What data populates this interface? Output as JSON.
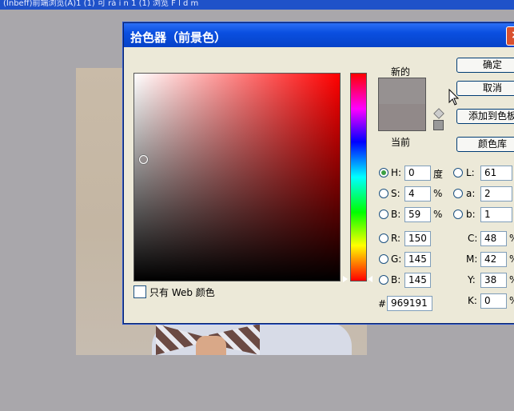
{
  "window": {
    "title": "(Inbeff)前端浏览(A)1 (1) 可 rà i n 1 (1) 浏览 F l d m"
  },
  "dialog": {
    "title": "拾色器（前景色）",
    "close_glyph": "×"
  },
  "preview": {
    "new_label": "新的",
    "current_label": "当前",
    "new_color": "#969191",
    "current_color": "#918989"
  },
  "buttons": {
    "ok": "确定",
    "cancel": "取消",
    "add_to_swatches": "添加到色板",
    "color_libraries": "颜色库"
  },
  "web_only_label": "只有 Web 颜色",
  "hsb": {
    "h": {
      "label": "H:",
      "value": "0",
      "unit": "度",
      "selected": true
    },
    "s": {
      "label": "S:",
      "value": "4",
      "unit": "%"
    },
    "b": {
      "label": "B:",
      "value": "59",
      "unit": "%"
    }
  },
  "rgb": {
    "r": {
      "label": "R:",
      "value": "150"
    },
    "g": {
      "label": "G:",
      "value": "145"
    },
    "b": {
      "label": "B:",
      "value": "145"
    }
  },
  "lab": {
    "l": {
      "label": "L:",
      "value": "61"
    },
    "a": {
      "label": "a:",
      "value": "2"
    },
    "b": {
      "label": "b:",
      "value": "1"
    }
  },
  "cmyk": {
    "c": {
      "label": "C:",
      "value": "48",
      "unit": "%"
    },
    "m": {
      "label": "M:",
      "value": "42",
      "unit": "%"
    },
    "y": {
      "label": "Y:",
      "value": "38",
      "unit": "%"
    },
    "k": {
      "label": "K:",
      "value": "0",
      "unit": "%"
    }
  },
  "hex": {
    "label": "#",
    "value": "969191"
  },
  "icons": {
    "cube": "cube-icon",
    "cursor": "cursor-icon"
  }
}
